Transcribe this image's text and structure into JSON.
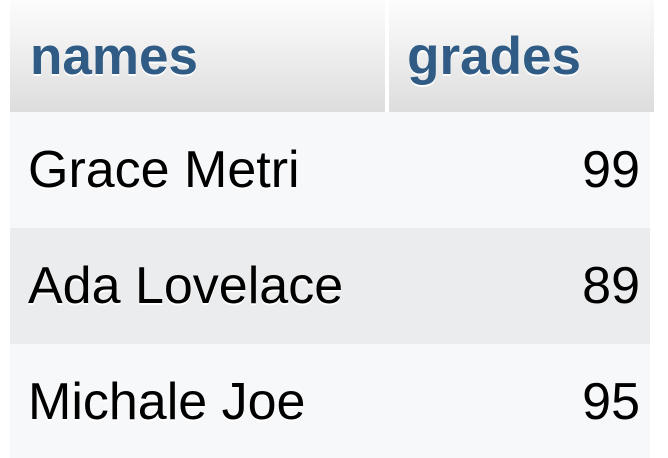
{
  "table": {
    "columns": [
      "names",
      "grades"
    ],
    "rows": [
      {
        "name": "Grace Metri",
        "grade": "99"
      },
      {
        "name": "Ada Lovelace",
        "grade": "89"
      },
      {
        "name": "Michale Joe",
        "grade": "95"
      }
    ]
  },
  "colors": {
    "header_text": "#2f5b85",
    "row_odd_bg": "#f7f8fa",
    "row_even_bg": "#ebecee"
  }
}
